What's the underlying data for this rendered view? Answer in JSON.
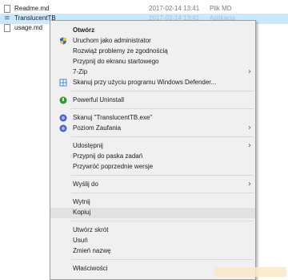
{
  "files": [
    {
      "name": "Readme.md",
      "date": "2017-02-14 13:41",
      "type": "Plik MD",
      "icon": "document-icon"
    },
    {
      "name": "TranslucentTB",
      "date": "2017-02-14 13:41",
      "type": "Aplikacja",
      "icon": "application-icon",
      "selected": true
    },
    {
      "name": "usage.md",
      "date": "",
      "type": "",
      "icon": "document-icon"
    }
  ],
  "menu": {
    "open": "Otwórz",
    "run_as_admin": "Uruchom jako administrator",
    "troubleshoot": "Rozwiąż problemy ze zgodnością",
    "pin_start": "Przypnij do ekranu startowego",
    "zip": "7-Zip",
    "defender": "Skanuj przy użyciu programu Windows Defender...",
    "powerful_uninstall": "Powerful Uninstall",
    "scan_file": "Skanuj \"TranslucentTB.exe\"",
    "trust_level": "Poziom Zaufania",
    "share": "Udostępnij",
    "pin_taskbar": "Przypnij do paska zadań",
    "restore_versions": "Przywróć poprzednie wersje",
    "send_to": "Wyślij do",
    "cut": "Wytnij",
    "copy": "Kopiuj",
    "create_shortcut": "Utwórz skrót",
    "delete": "Usuń",
    "rename": "Zmień nazwę",
    "properties": "Właściwości"
  },
  "colors": {
    "selection": "#cce8ff",
    "menu_background": "#f0f0f0",
    "hover": "#e2e2e2"
  }
}
